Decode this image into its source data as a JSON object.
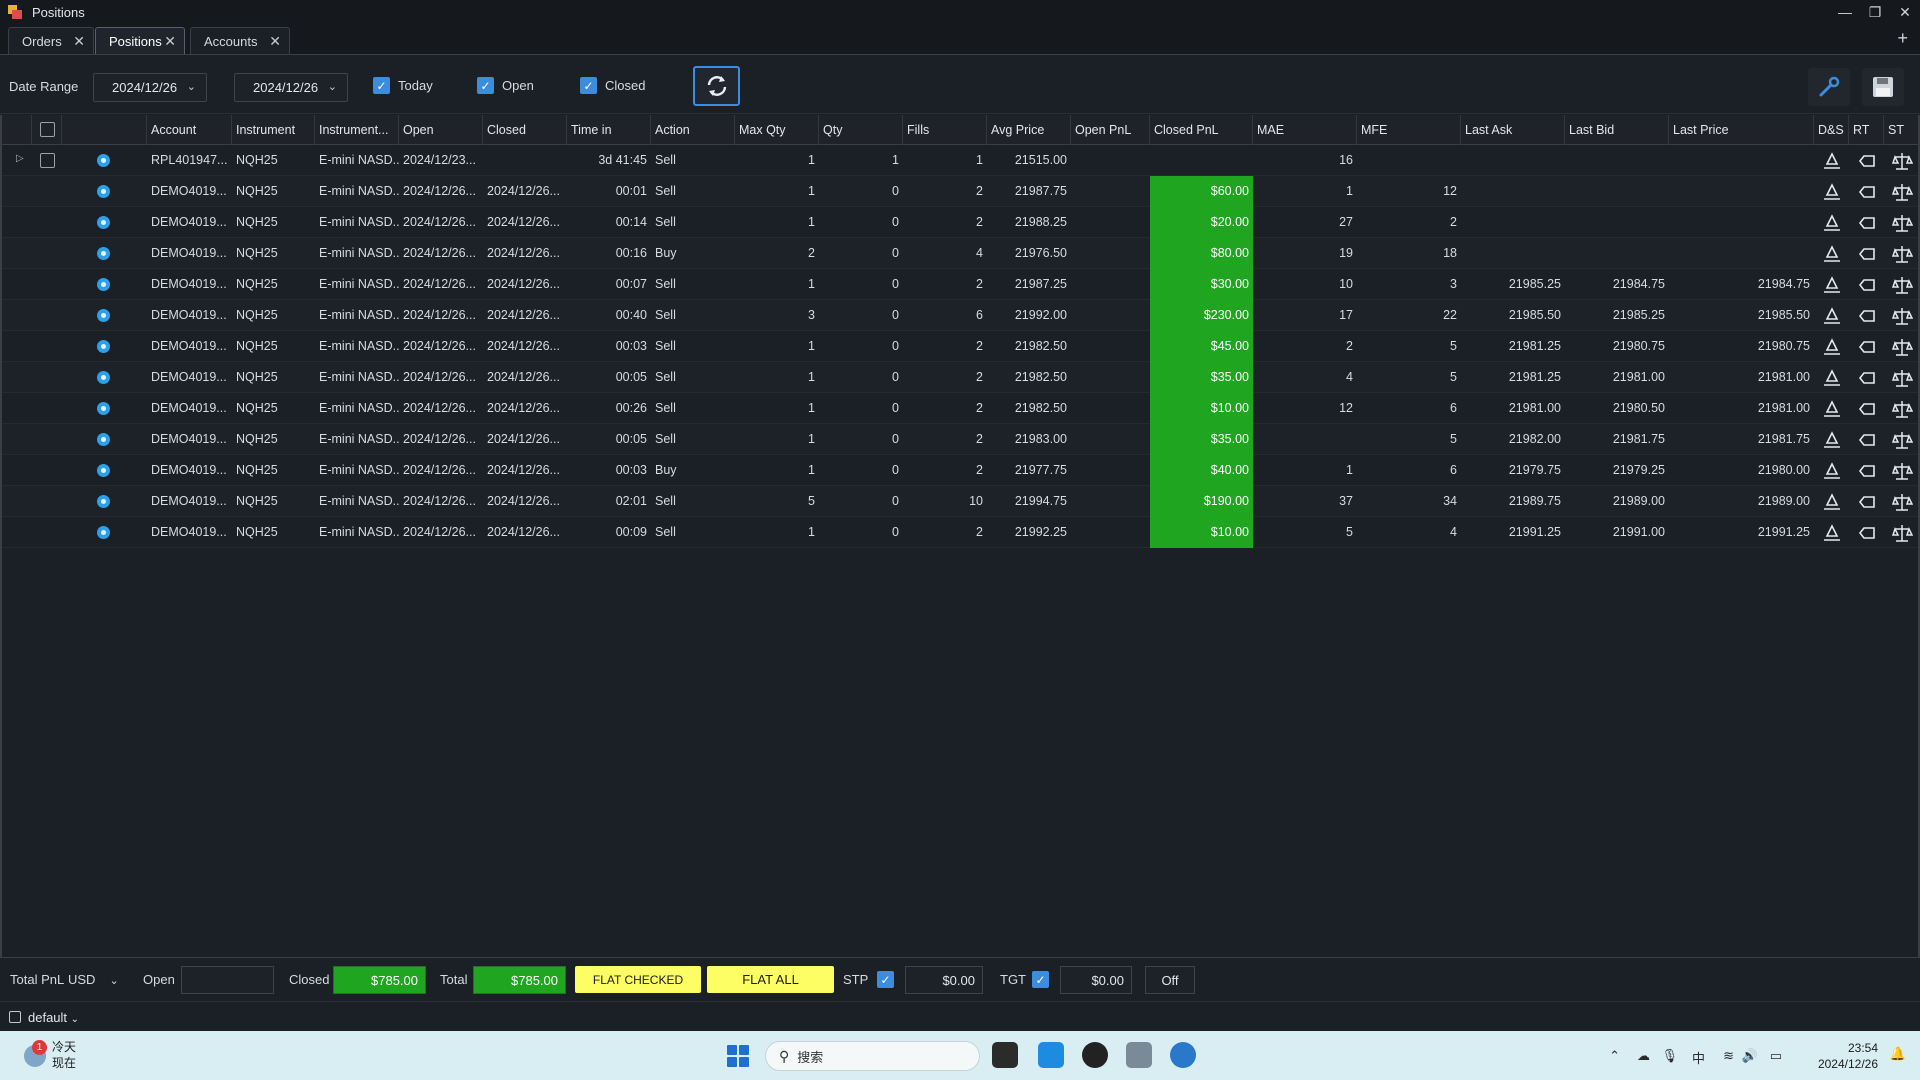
{
  "window": {
    "title": "Positions"
  },
  "tabs": [
    {
      "label": "Orders"
    },
    {
      "label": "Positions"
    },
    {
      "label": "Accounts"
    }
  ],
  "toolbar": {
    "date_range_label": "Date Range",
    "date_from": "2024/12/26",
    "date_to": "2024/12/26",
    "today_label": "Today",
    "open_label": "Open",
    "closed_label": "Closed"
  },
  "columns": [
    "Account",
    "Instrument",
    "Instrument...",
    "Open",
    "Closed",
    "Time in",
    "Action",
    "Max Qty",
    "Qty",
    "Fills",
    "Avg Price",
    "Open PnL",
    "Closed PnL",
    "MAE",
    "MFE",
    "Last Ask",
    "Last Bid",
    "Last Price",
    "D&S",
    "RT",
    "ST"
  ],
  "rows": [
    {
      "account": "RPL401947...",
      "instrument": "NQH25",
      "desc": "E-mini NASD...",
      "open": "2024/12/23...",
      "closed": "",
      "time_in": "3d 41:45",
      "action": "Sell",
      "max_qty": "1",
      "qty": "1",
      "fills": "1",
      "avg_price": "21515.00",
      "open_pnl": "",
      "closed_pnl": "",
      "mae": "16",
      "mfe": "",
      "last_ask": "",
      "last_bid": "",
      "last_price": ""
    },
    {
      "account": "DEMO4019...",
      "instrument": "NQH25",
      "desc": "E-mini NASD...",
      "open": "2024/12/26...",
      "closed": "2024/12/26...",
      "time_in": "00:01",
      "action": "Sell",
      "max_qty": "1",
      "qty": "0",
      "fills": "2",
      "avg_price": "21987.75",
      "open_pnl": "",
      "closed_pnl": "$60.00",
      "mae": "1",
      "mfe": "12",
      "last_ask": "",
      "last_bid": "",
      "last_price": ""
    },
    {
      "account": "DEMO4019...",
      "instrument": "NQH25",
      "desc": "E-mini NASD...",
      "open": "2024/12/26...",
      "closed": "2024/12/26...",
      "time_in": "00:14",
      "action": "Sell",
      "max_qty": "1",
      "qty": "0",
      "fills": "2",
      "avg_price": "21988.25",
      "open_pnl": "",
      "closed_pnl": "$20.00",
      "mae": "27",
      "mfe": "2",
      "last_ask": "",
      "last_bid": "",
      "last_price": ""
    },
    {
      "account": "DEMO4019...",
      "instrument": "NQH25",
      "desc": "E-mini NASD...",
      "open": "2024/12/26...",
      "closed": "2024/12/26...",
      "time_in": "00:16",
      "action": "Buy",
      "max_qty": "2",
      "qty": "0",
      "fills": "4",
      "avg_price": "21976.50",
      "open_pnl": "",
      "closed_pnl": "$80.00",
      "mae": "19",
      "mfe": "18",
      "last_ask": "",
      "last_bid": "",
      "last_price": ""
    },
    {
      "account": "DEMO4019...",
      "instrument": "NQH25",
      "desc": "E-mini NASD...",
      "open": "2024/12/26...",
      "closed": "2024/12/26...",
      "time_in": "00:07",
      "action": "Sell",
      "max_qty": "1",
      "qty": "0",
      "fills": "2",
      "avg_price": "21987.25",
      "open_pnl": "",
      "closed_pnl": "$30.00",
      "mae": "10",
      "mfe": "3",
      "last_ask": "21985.25",
      "last_bid": "21984.75",
      "last_price": "21984.75"
    },
    {
      "account": "DEMO4019...",
      "instrument": "NQH25",
      "desc": "E-mini NASD...",
      "open": "2024/12/26...",
      "closed": "2024/12/26...",
      "time_in": "00:40",
      "action": "Sell",
      "max_qty": "3",
      "qty": "0",
      "fills": "6",
      "avg_price": "21992.00",
      "open_pnl": "",
      "closed_pnl": "$230.00",
      "mae": "17",
      "mfe": "22",
      "last_ask": "21985.50",
      "last_bid": "21985.25",
      "last_price": "21985.50"
    },
    {
      "account": "DEMO4019...",
      "instrument": "NQH25",
      "desc": "E-mini NASD...",
      "open": "2024/12/26...",
      "closed": "2024/12/26...",
      "time_in": "00:03",
      "action": "Sell",
      "max_qty": "1",
      "qty": "0",
      "fills": "2",
      "avg_price": "21982.50",
      "open_pnl": "",
      "closed_pnl": "$45.00",
      "mae": "2",
      "mfe": "5",
      "last_ask": "21981.25",
      "last_bid": "21980.75",
      "last_price": "21980.75"
    },
    {
      "account": "DEMO4019...",
      "instrument": "NQH25",
      "desc": "E-mini NASD...",
      "open": "2024/12/26...",
      "closed": "2024/12/26...",
      "time_in": "00:05",
      "action": "Sell",
      "max_qty": "1",
      "qty": "0",
      "fills": "2",
      "avg_price": "21982.50",
      "open_pnl": "",
      "closed_pnl": "$35.00",
      "mae": "4",
      "mfe": "5",
      "last_ask": "21981.25",
      "last_bid": "21981.00",
      "last_price": "21981.00"
    },
    {
      "account": "DEMO4019...",
      "instrument": "NQH25",
      "desc": "E-mini NASD...",
      "open": "2024/12/26...",
      "closed": "2024/12/26...",
      "time_in": "00:26",
      "action": "Sell",
      "max_qty": "1",
      "qty": "0",
      "fills": "2",
      "avg_price": "21982.50",
      "open_pnl": "",
      "closed_pnl": "$10.00",
      "mae": "12",
      "mfe": "6",
      "last_ask": "21981.00",
      "last_bid": "21980.50",
      "last_price": "21981.00"
    },
    {
      "account": "DEMO4019...",
      "instrument": "NQH25",
      "desc": "E-mini NASD...",
      "open": "2024/12/26...",
      "closed": "2024/12/26...",
      "time_in": "00:05",
      "action": "Sell",
      "max_qty": "1",
      "qty": "0",
      "fills": "2",
      "avg_price": "21983.00",
      "open_pnl": "",
      "closed_pnl": "$35.00",
      "mae": "",
      "mfe": "5",
      "last_ask": "21982.00",
      "last_bid": "21981.75",
      "last_price": "21981.75"
    },
    {
      "account": "DEMO4019...",
      "instrument": "NQH25",
      "desc": "E-mini NASD...",
      "open": "2024/12/26...",
      "closed": "2024/12/26...",
      "time_in": "00:03",
      "action": "Buy",
      "max_qty": "1",
      "qty": "0",
      "fills": "2",
      "avg_price": "21977.75",
      "open_pnl": "",
      "closed_pnl": "$40.00",
      "mae": "1",
      "mfe": "6",
      "last_ask": "21979.75",
      "last_bid": "21979.25",
      "last_price": "21980.00"
    },
    {
      "account": "DEMO4019...",
      "instrument": "NQH25",
      "desc": "E-mini NASD...",
      "open": "2024/12/26...",
      "closed": "2024/12/26...",
      "time_in": "02:01",
      "action": "Sell",
      "max_qty": "5",
      "qty": "0",
      "fills": "10",
      "avg_price": "21994.75",
      "open_pnl": "",
      "closed_pnl": "$190.00",
      "mae": "37",
      "mfe": "34",
      "last_ask": "21989.75",
      "last_bid": "21989.00",
      "last_price": "21989.00"
    },
    {
      "account": "DEMO4019...",
      "instrument": "NQH25",
      "desc": "E-mini NASD...",
      "open": "2024/12/26...",
      "closed": "2024/12/26...",
      "time_in": "00:09",
      "action": "Sell",
      "max_qty": "1",
      "qty": "0",
      "fills": "2",
      "avg_price": "21992.25",
      "open_pnl": "",
      "closed_pnl": "$10.00",
      "mae": "5",
      "mfe": "4",
      "last_ask": "21991.25",
      "last_bid": "21991.00",
      "last_price": "21991.25"
    }
  ],
  "footer": {
    "total_pnl_label": "Total PnL",
    "currency": "USD",
    "open_label": "Open",
    "open_value": "",
    "closed_label": "Closed",
    "closed_value": "$785.00",
    "total_label": "Total",
    "total_value": "$785.00",
    "flat_checked_label": "FLAT CHECKED",
    "flat_all_label": "FLAT ALL",
    "stp_label": "STP",
    "stp_value": "$0.00",
    "tgt_label": "TGT",
    "tgt_value": "$0.00",
    "off_label": "Off"
  },
  "status": {
    "workspace": "default"
  },
  "taskbar": {
    "weather_title": "冷天",
    "weather_sub": "现在",
    "weather_badge": "1",
    "search_placeholder": "搜索",
    "ime": "中",
    "time": "23:54",
    "date": "2024/12/26"
  },
  "colors": {
    "pnl_green": "#1fa51f",
    "accent_blue": "#3c8dde",
    "flat_yellow": "#fdfd64",
    "background": "#1b1f26"
  }
}
